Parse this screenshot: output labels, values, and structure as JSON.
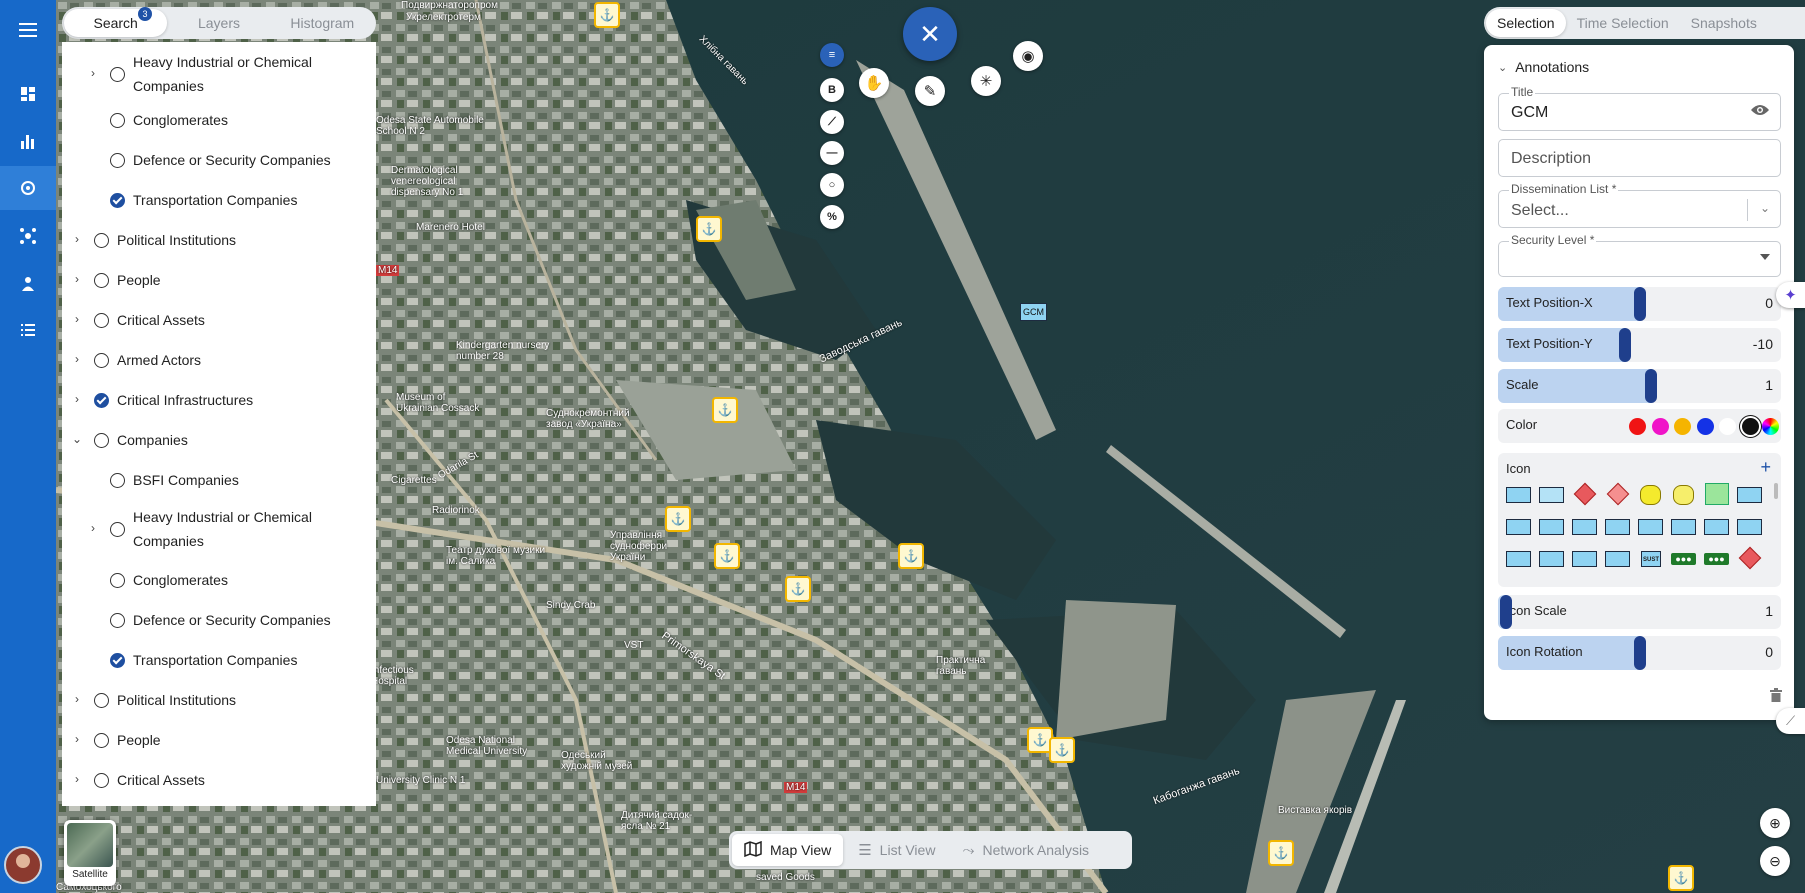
{
  "left_tabs": {
    "search": "Search",
    "search_badge": "3",
    "layers": "Layers",
    "histogram": "Histogram"
  },
  "tree": [
    {
      "label": "Heavy Industrial or Chemical Companies",
      "level": 2,
      "chevron": "›",
      "checked": false
    },
    {
      "label": "Conglomerates",
      "level": 2,
      "chevron": "",
      "checked": false
    },
    {
      "label": "Defence or Security Companies",
      "level": 2,
      "chevron": "",
      "checked": false
    },
    {
      "label": "Transportation Companies",
      "level": 2,
      "chevron": "",
      "checked": true
    },
    {
      "label": "Political Institutions",
      "level": 1,
      "chevron": "›",
      "checked": false
    },
    {
      "label": "People",
      "level": 1,
      "chevron": "›",
      "checked": false
    },
    {
      "label": "Critical Assets",
      "level": 1,
      "chevron": "›",
      "checked": false
    },
    {
      "label": "Armed Actors",
      "level": 1,
      "chevron": "›",
      "checked": false
    },
    {
      "label": "Critical Infrastructures",
      "level": 1,
      "chevron": "›",
      "checked": true
    },
    {
      "label": "Companies",
      "level": 1,
      "chevron": "⌄",
      "checked": false
    },
    {
      "label": "BSFI Companies",
      "level": 2,
      "chevron": "",
      "checked": false
    },
    {
      "label": "Heavy Industrial or Chemical Companies",
      "level": 2,
      "chevron": "›",
      "checked": false
    },
    {
      "label": "Conglomerates",
      "level": 2,
      "chevron": "",
      "checked": false
    },
    {
      "label": "Defence or Security Companies",
      "level": 2,
      "chevron": "",
      "checked": false
    },
    {
      "label": "Transportation Companies",
      "level": 2,
      "chevron": "",
      "checked": true
    },
    {
      "label": "Political Institutions",
      "level": 1,
      "chevron": "›",
      "checked": false
    },
    {
      "label": "People",
      "level": 1,
      "chevron": "›",
      "checked": false
    },
    {
      "label": "Critical Assets",
      "level": 1,
      "chevron": "›",
      "checked": false
    }
  ],
  "toolbar": {
    "close": "✕",
    "bold": "B"
  },
  "right_tabs": {
    "selection": "Selection",
    "time_selection": "Time Selection",
    "snapshots": "Snapshots"
  },
  "annotations": {
    "header": "Annotations",
    "title_legend": "Title",
    "title_value": "GCM",
    "description_placeholder": "Description",
    "dissemination_legend": "Dissemination List *",
    "dissemination_placeholder": "Select...",
    "security_legend": "Security Level *",
    "sliders": [
      {
        "label": "Text Position-X",
        "value": "0",
        "level": 0.5
      },
      {
        "label": "Text Position-Y",
        "value": "-10",
        "level": 0.45
      },
      {
        "label": "Scale",
        "value": "1",
        "level": 0.54
      }
    ],
    "color_label": "Color",
    "colors": [
      "#f01414",
      "#f014c8",
      "#f5b400",
      "#1432e6",
      "#ffffff",
      "#111111"
    ],
    "icon_label": "Icon",
    "icon_scale_label": "Icon Scale",
    "icon_scale_value": "1",
    "icon_scale_level": 0.03,
    "icon_rotation_label": "Icon Rotation",
    "icon_rotation_value": "0",
    "icon_rotation_level": 0.5,
    "glyph_labels": [
      "SUST"
    ]
  },
  "map": {
    "gcm_label": "GCM",
    "place_labels": [
      "Подвиржнаторопром",
      "Укрелектротерм",
      "Хлібна гавань",
      "Odesa State Automobile School N 2",
      "Dermatological venereological dispensary No 1",
      "Marenero Hotel",
      "Kindergarten nursery number 28",
      "Museum of Ukrainian Cossack",
      "Суднокремонтний завод «Україна»",
      "Заводська гавань",
      "Cigarettes",
      "Radiorinok",
      "Odarila St",
      "Управління судноферри України",
      "Театр духової музики ім. Салика",
      "Sindy Crab",
      "VST",
      "Primorskaya St",
      "Практична гавань",
      "Infectious Hospital",
      "Odesa National Medical University",
      "Одеський художній музей",
      "University Clinic N 1",
      "Дитячий садок-ясла № 21",
      "Кабоганжа гавань",
      "Виставка якорів",
      "saved Goods",
      "Самохоцького",
      "M14",
      "M14"
    ]
  },
  "view_switch": {
    "map_view": "Map View",
    "list_view": "List View",
    "network_analysis": "Network Analysis"
  },
  "basemap": {
    "label": "Satellite"
  },
  "icons": {
    "menu": "menu-icon",
    "dashboard": "dashboard-icon",
    "chart": "bar-chart-icon",
    "target": "location-target-icon",
    "network": "network-icon",
    "person-pin": "person-pin-icon",
    "list": "list-icon",
    "eye": "eye-icon",
    "trash": "trash-icon",
    "plus": "plus-icon"
  }
}
